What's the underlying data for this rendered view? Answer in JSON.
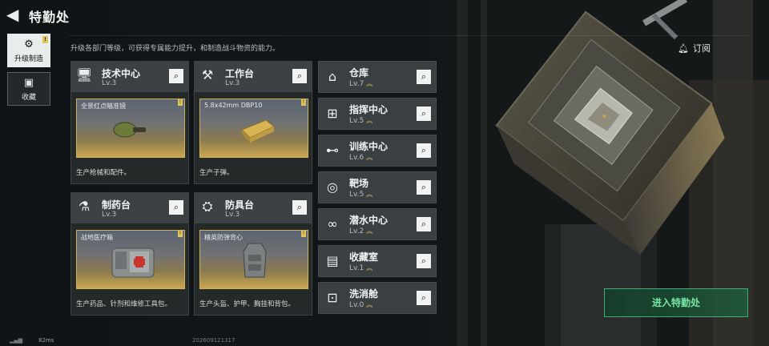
{
  "header": {
    "title": "特勤处",
    "back_icon": "back-arrow-icon"
  },
  "subtitle": "升级各部门等级，可获得专属能力提升，和制造战斗物资的能力。",
  "subscribe": {
    "label": "订阅",
    "icon": "bell-icon"
  },
  "nav": [
    {
      "label": "升级制造",
      "active": true,
      "badge": "!"
    },
    {
      "label": "收藏",
      "active": false
    }
  ],
  "cards": [
    {
      "name": "技术中心",
      "level": "Lv.3",
      "item": "全景红点瞄准镜",
      "desc": "生产枪械和配件。",
      "badge": "!"
    },
    {
      "name": "工作台",
      "level": "Lv.3",
      "item": "5.8x42mm DBP10",
      "desc": "生产子弹。",
      "badge": "!"
    },
    {
      "name": "制药台",
      "level": "Lv.3",
      "item": "战地医疗箱",
      "desc": "生产药品、针剂和维修工具包。",
      "badge": "!"
    },
    {
      "name": "防具台",
      "level": "Lv.3",
      "item": "精英防弹背心",
      "desc": "生产头盔、护甲、胸挂和背包。",
      "badge": "!"
    }
  ],
  "facilities": [
    {
      "name": "仓库",
      "level": "Lv.7"
    },
    {
      "name": "指挥中心",
      "level": "Lv.5"
    },
    {
      "name": "训练中心",
      "level": "Lv.6"
    },
    {
      "name": "靶场",
      "level": "Lv.5"
    },
    {
      "name": "潜水中心",
      "level": "Lv.2"
    },
    {
      "name": "收藏室",
      "level": "Lv.1"
    },
    {
      "name": "洗消舱",
      "level": "Lv.0"
    }
  ],
  "enter_button": "进入特勤处",
  "status": {
    "ping": "82ms",
    "uid": "202609121317"
  },
  "colors": {
    "accent_green": "#3fae72",
    "gold": "#e0c35a"
  }
}
